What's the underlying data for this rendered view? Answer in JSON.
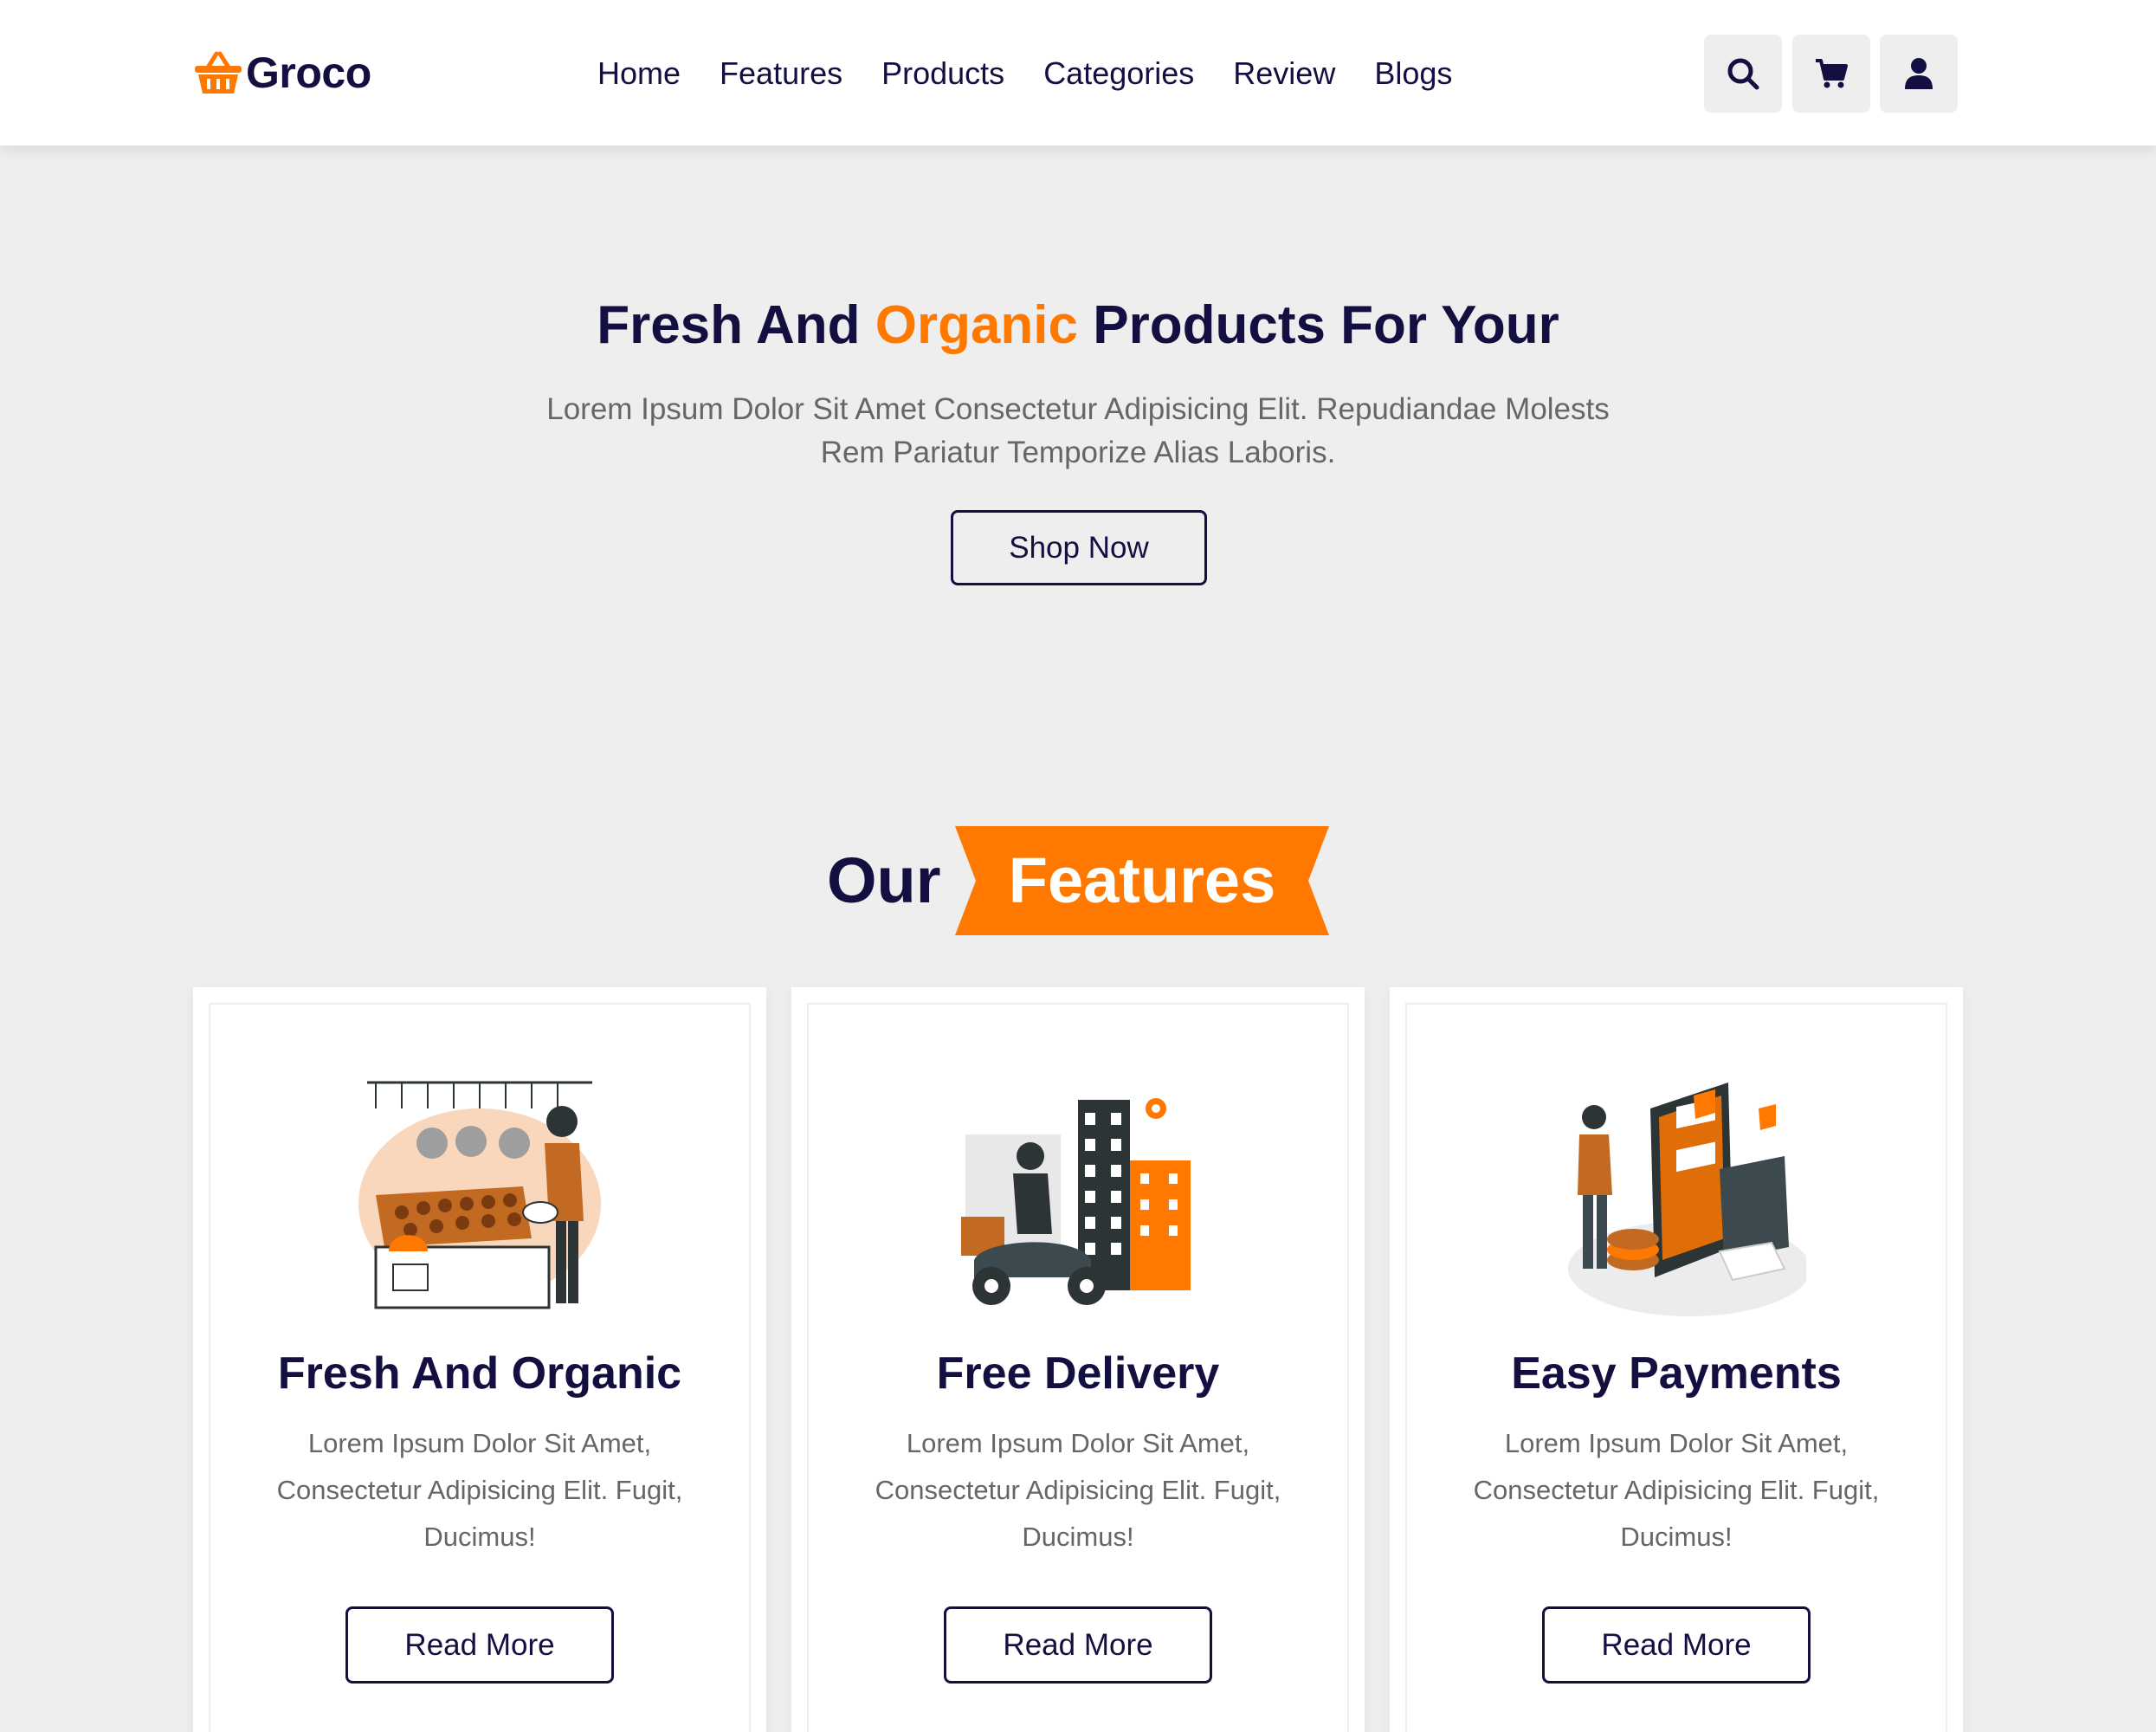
{
  "brand": {
    "name": "Groco",
    "accent_color": "#ff7800",
    "primary_color": "#130f40",
    "logo_icon": "basket-icon"
  },
  "nav": {
    "items": [
      "Home",
      "Features",
      "Products",
      "Categories",
      "Review",
      "Blogs"
    ]
  },
  "header_icons": [
    "search-icon",
    "cart-icon",
    "user-icon"
  ],
  "hero": {
    "title_part1": "Fresh And ",
    "title_accent": "Organic",
    "title_part2": " Products For Your",
    "subtitle": "Lorem Ipsum Dolor Sit Amet Consectetur Adipisicing Elit. Repudiandae Molests Rem Pariatur Temporize Alias Laboris.",
    "button": "Shop Now"
  },
  "features": {
    "heading_plain": "Our",
    "heading_banner": "Features",
    "cards": [
      {
        "title": "Fresh And Organic",
        "text": "Lorem Ipsum Dolor Sit Amet, Consectetur Adipisicing Elit. Fugit, Ducimus!",
        "button": "Read More",
        "illustration": "market-stall-illustration"
      },
      {
        "title": "Free Delivery",
        "text": "Lorem Ipsum Dolor Sit Amet, Consectetur Adipisicing Elit. Fugit, Ducimus!",
        "button": "Read More",
        "illustration": "delivery-scooter-illustration"
      },
      {
        "title": "Easy Payments",
        "text": "Lorem Ipsum Dolor Sit Amet, Consectetur Adipisicing Elit. Fugit, Ducimus!",
        "button": "Read More",
        "illustration": "mobile-payment-illustration"
      }
    ]
  }
}
